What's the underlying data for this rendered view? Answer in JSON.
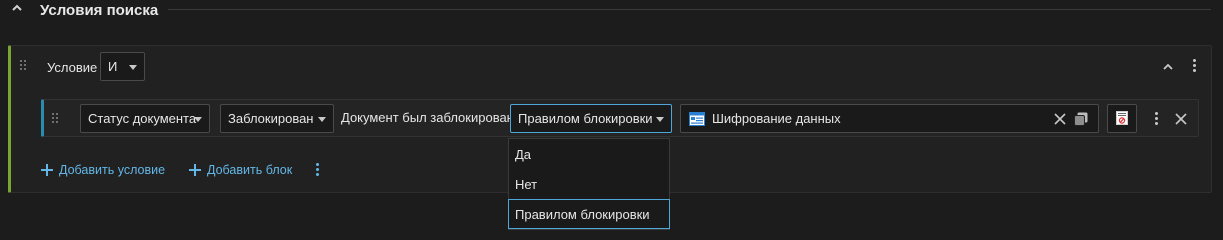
{
  "section": {
    "title": "Условия поиска",
    "collapse_icon": "chevron-up-icon"
  },
  "group": {
    "label": "Условие",
    "operator": "И",
    "add_condition": "Добавить условие",
    "add_block": "Добавить блок"
  },
  "condition": {
    "field": "Статус документа",
    "status": "Заблокирован",
    "label": "Документ был заблокирован:",
    "method": "Правилом блокировки",
    "value": "Шифрование данных"
  },
  "dropdown": {
    "options": [
      "Да",
      "Нет",
      "Правилом блокировки"
    ],
    "selected": "Правилом блокировки"
  },
  "colors": {
    "group_accent": "#7aa533",
    "row_accent": "#2a8cb0",
    "link": "#63b6e6",
    "selected_border": "#4ea7d8"
  }
}
